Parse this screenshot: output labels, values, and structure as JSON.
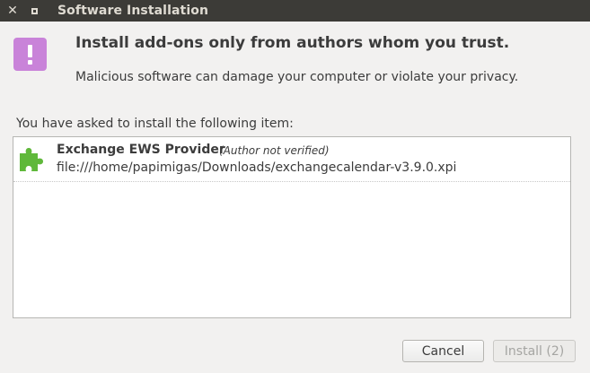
{
  "window": {
    "title": "Software Installation"
  },
  "dialog": {
    "heading": "Install add-ons only from authors whom you trust.",
    "message": "Malicious software can damage your computer or violate your privacy.",
    "list_label": "You have asked to install the following item:"
  },
  "items": [
    {
      "name": "Exchange EWS Provider",
      "note": "(Author not verified)",
      "url": "file:///home/papimigas/Downloads/exchangecalendar-v3.9.0.xpi",
      "icon": "puzzle-piece-icon"
    }
  ],
  "buttons": {
    "cancel": "Cancel",
    "install": "Install (2)"
  },
  "colors": {
    "titlebar": "#3c3b37",
    "warning_icon": "#c983d9",
    "addon_icon": "#5fb83a"
  }
}
